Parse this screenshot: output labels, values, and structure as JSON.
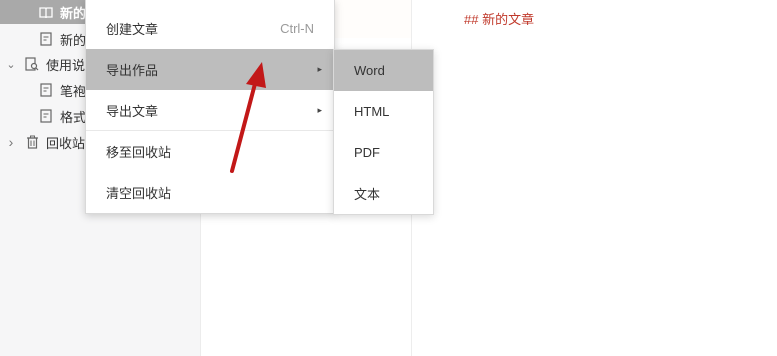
{
  "sidebar": {
    "items": [
      {
        "label": "新的",
        "icon": "book-icon",
        "chevron": "",
        "active": true
      },
      {
        "label": "新的",
        "icon": "document-icon",
        "chevron": "",
        "active": false
      },
      {
        "label": "使用说",
        "icon": "search-document-icon",
        "chevron": "⌄",
        "active": false
      },
      {
        "label": "笔袍",
        "icon": "document-icon",
        "chevron": "",
        "active": false
      },
      {
        "label": "格式",
        "icon": "document-icon",
        "chevron": "",
        "active": false
      },
      {
        "label": "回收站",
        "icon": "trash-icon",
        "chevron": "›",
        "active": false
      }
    ]
  },
  "editor": {
    "heading": "## 新的文章"
  },
  "context_menu": {
    "items": [
      {
        "label": "创建文章",
        "shortcut": "Ctrl-N",
        "has_submenu": false
      },
      {
        "label": "导出作品",
        "shortcut": "",
        "has_submenu": true,
        "highlighted": true
      },
      {
        "label": "导出文章",
        "shortcut": "",
        "has_submenu": true
      },
      {
        "label": "移至回收站",
        "shortcut": "",
        "has_submenu": false
      },
      {
        "label": "清空回收站",
        "shortcut": "",
        "has_submenu": false
      }
    ],
    "submenu_arrow": "▸"
  },
  "export_submenu": {
    "items": [
      {
        "label": "Word",
        "highlighted": true
      },
      {
        "label": "HTML"
      },
      {
        "label": "PDF"
      },
      {
        "label": "文本"
      }
    ]
  },
  "colors": {
    "accent_red": "#c0392b",
    "highlight_gray": "#bdbdbd",
    "sidebar_active": "#a9a9a9"
  }
}
